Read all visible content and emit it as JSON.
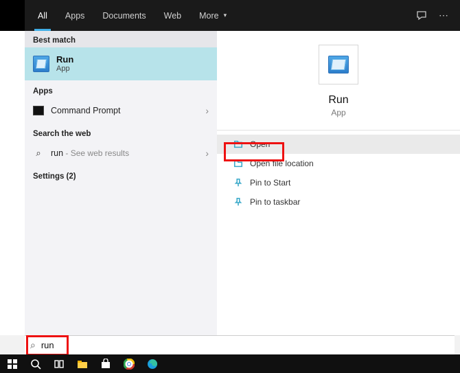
{
  "tabs": {
    "all": "All",
    "apps": "Apps",
    "documents": "Documents",
    "web": "Web",
    "more": "More"
  },
  "sections": {
    "best": "Best match",
    "apps": "Apps",
    "web": "Search the web",
    "settings": "Settings (2)"
  },
  "best": {
    "title": "Run",
    "subtitle": "App"
  },
  "app_rows": {
    "cmd": "Command Prompt"
  },
  "web_row": {
    "query": "run",
    "secondary": " - See web results"
  },
  "detail": {
    "title": "Run",
    "subtitle": "App"
  },
  "actions": {
    "open": "Open",
    "open_location": "Open file location",
    "pin_start": "Pin to Start",
    "pin_taskbar": "Pin to taskbar"
  },
  "search": {
    "value": "run"
  },
  "settings_count": 2
}
